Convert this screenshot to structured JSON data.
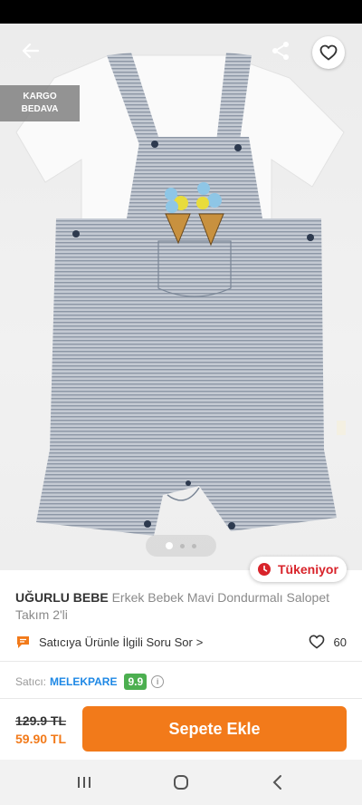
{
  "header": {
    "back_icon": "arrow-left-icon",
    "share_icon": "share-icon",
    "favorite_icon": "heart-outline-icon"
  },
  "badges": {
    "cargo_line1": "KARGO",
    "cargo_line2": "BEDAVA",
    "sold_out": "Tükeniyor"
  },
  "gallery": {
    "page_count": 3,
    "active_index": 0
  },
  "product": {
    "brand": "UĞURLU BEBE",
    "name": "Erkek Bebek Mavi Dondurmalı Salopet Takım 2'li"
  },
  "question": {
    "label": "Satıcıya Ürünle İlgili Soru Sor",
    "chevron": ">"
  },
  "likes": {
    "count": "60"
  },
  "seller": {
    "label": "Satıcı:",
    "name": "MELEKPARE",
    "score": "9.9",
    "info": "i"
  },
  "price": {
    "old": "129.9 TL",
    "new": "59.90 TL"
  },
  "cart": {
    "label": "Sepete Ekle"
  },
  "colors": {
    "accent": "#f27a1a",
    "seller_link": "#1e88e5",
    "score_bg": "#4caf50",
    "sold_out": "#d8232a"
  }
}
